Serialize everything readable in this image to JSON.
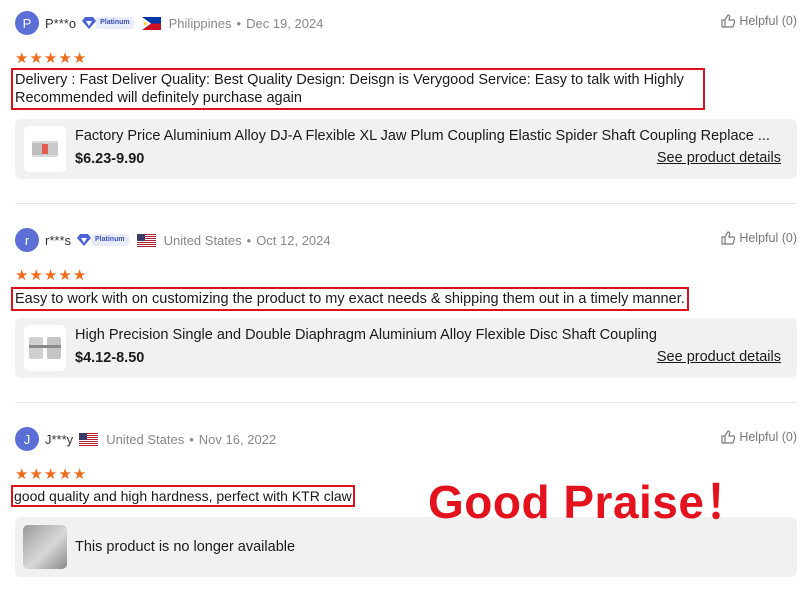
{
  "colors": {
    "accent_red": "#e3121c",
    "star_orange": "#f26a1b",
    "avatar_blue": "#5b6fd6"
  },
  "reviews": [
    {
      "avatar": "P",
      "user": "P***o",
      "badge": "Platinum",
      "flag_icon": "philippines-flag-icon",
      "country": "Philippines",
      "date": "Dec 19, 2024",
      "helpful": "Helpful (0)",
      "stars": 5,
      "text": "Delivery : Fast Deliver Quality: Best Quality Design: Deisgn is Verygood Service: Easy to talk with Highly Recommended will definitely purchase again",
      "product": {
        "name": "Factory Price Aluminium Alloy DJ-A Flexible XL Jaw Plum Coupling Elastic Spider Shaft Coupling Replace ...",
        "price": "$6.23-9.90",
        "details": "See product details"
      }
    },
    {
      "avatar": "r",
      "user": "r***s",
      "badge": "Platinum",
      "flag_icon": "us-flag-icon",
      "country": "United States",
      "date": "Oct 12, 2024",
      "helpful": "Helpful (0)",
      "stars": 5,
      "text": "Easy to work with on customizing the product to my exact needs & shipping them out in a timely manner.",
      "product": {
        "name": "High Precision Single and Double Diaphragm Aluminium Alloy Flexible Disc Shaft Coupling",
        "price": "$4.12-8.50",
        "details": "See product details"
      }
    },
    {
      "avatar": "J",
      "user": "J***y",
      "flag_icon": "us-flag-icon",
      "country": "United States",
      "date": "Nov 16, 2022",
      "helpful": "Helpful (0)",
      "stars": 5,
      "text": "good quality and high hardness, perfect with KTR claw",
      "product": {
        "unavailable": "This product is no longer available"
      }
    }
  ],
  "overlay": {
    "praise": "Good Praise！"
  }
}
